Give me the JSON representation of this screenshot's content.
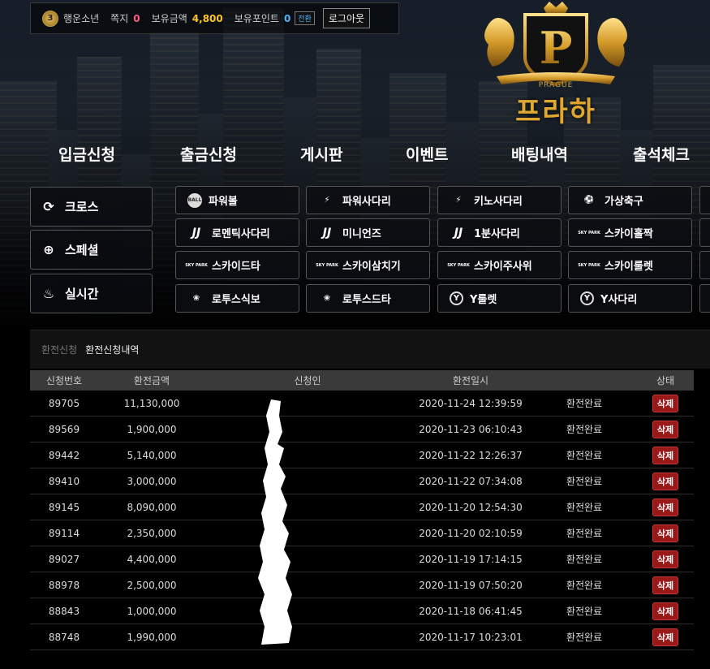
{
  "topbar": {
    "level_badge": "3",
    "username": "행운소년",
    "memo_label": "쪽지",
    "memo_count": "0",
    "balance_label": "보유금액",
    "balance_value": "4,800",
    "points_label": "보유포인트",
    "points_value": "0",
    "convert_label": "전환",
    "logout_label": "로그아웃"
  },
  "logo": {
    "sub": "PRAGUE",
    "word": "프라하",
    "letter": "P"
  },
  "mainnav": [
    "입금신청",
    "출금신청",
    "게시판",
    "이벤트",
    "배팅내역",
    "출석체크"
  ],
  "side_menu": [
    {
      "label": "크로스",
      "icon": "refresh-icon"
    },
    {
      "label": "스페셜",
      "icon": "plus-circle-icon"
    },
    {
      "label": "실시간",
      "icon": "flame-icon"
    }
  ],
  "games": [
    [
      {
        "label": "파워볼",
        "icon": "ball-icon",
        "icon_text": "BALL"
      },
      {
        "label": "파워사다리",
        "icon": "ladder-icon",
        "icon_text": "⚡"
      },
      {
        "label": "키노사다리",
        "icon": "ladder-icon",
        "icon_text": "⚡"
      },
      {
        "label": "가상축구",
        "icon": "soccer-icon",
        "icon_text": "⚽"
      }
    ],
    [
      {
        "label": "로멘틱사다리",
        "icon": "jj-icon",
        "icon_text": "JJ"
      },
      {
        "label": "미니언즈",
        "icon": "jj-icon",
        "icon_text": "JJ"
      },
      {
        "label": "1분사다리",
        "icon": "jj-icon",
        "icon_text": "JJ"
      },
      {
        "label": "스카이홀짝",
        "icon": "skypark-icon",
        "icon_text": "SKY PARK"
      }
    ],
    [
      {
        "label": "스카이드타",
        "icon": "skypark-icon",
        "icon_text": "SKY PARK"
      },
      {
        "label": "스카이삼치기",
        "icon": "skypark-icon",
        "icon_text": "SKY PARK"
      },
      {
        "label": "스카이주사위",
        "icon": "skypark-icon",
        "icon_text": "SKY PARK"
      },
      {
        "label": "스카이룰렛",
        "icon": "skypark-icon",
        "icon_text": "SKY PARK"
      }
    ],
    [
      {
        "label": "로투스식보",
        "icon": "lotus-icon",
        "icon_text": "❀"
      },
      {
        "label": "로투스드타",
        "icon": "lotus-icon",
        "icon_text": "❀"
      },
      {
        "label": "Y룰렛",
        "icon": "y-icon",
        "icon_text": "Y"
      },
      {
        "label": "Y사다리",
        "icon": "y-icon",
        "icon_text": "Y"
      }
    ]
  ],
  "exchange": {
    "tabs": [
      "환전신청",
      "환전신청내역"
    ],
    "headers": [
      "신청번호",
      "환전금액",
      "신청인",
      "환전일시",
      "",
      "상태"
    ],
    "delete_label": "삭제",
    "rows": [
      {
        "id": "89705",
        "amount": "11,130,000",
        "date": "2020-11-24 12:39:59",
        "status": "환전완료"
      },
      {
        "id": "89569",
        "amount": "1,900,000",
        "date": "2020-11-23 06:10:43",
        "status": "환전완료"
      },
      {
        "id": "89442",
        "amount": "5,140,000",
        "date": "2020-11-22 12:26:37",
        "status": "환전완료"
      },
      {
        "id": "89410",
        "amount": "3,000,000",
        "date": "2020-11-22 07:34:08",
        "status": "환전완료"
      },
      {
        "id": "89145",
        "amount": "8,090,000",
        "date": "2020-11-20 12:54:30",
        "status": "환전완료"
      },
      {
        "id": "89114",
        "amount": "2,350,000",
        "date": "2020-11-20 02:10:59",
        "status": "환전완료"
      },
      {
        "id": "89027",
        "amount": "4,400,000",
        "date": "2020-11-19 17:14:15",
        "status": "환전완료"
      },
      {
        "id": "88978",
        "amount": "2,500,000",
        "date": "2020-11-19 07:50:20",
        "status": "환전완료"
      },
      {
        "id": "88843",
        "amount": "1,000,000",
        "date": "2020-11-18 06:41:45",
        "status": "환전완료"
      },
      {
        "id": "88748",
        "amount": "1,990,000",
        "date": "2020-11-17 10:23:01",
        "status": "환전완료"
      }
    ]
  },
  "colors": {
    "accent_gold": "#ffc51a",
    "memo_pink": "#ff5a86",
    "delete_red": "#9a1818",
    "logo_gold": "#e0a830"
  }
}
